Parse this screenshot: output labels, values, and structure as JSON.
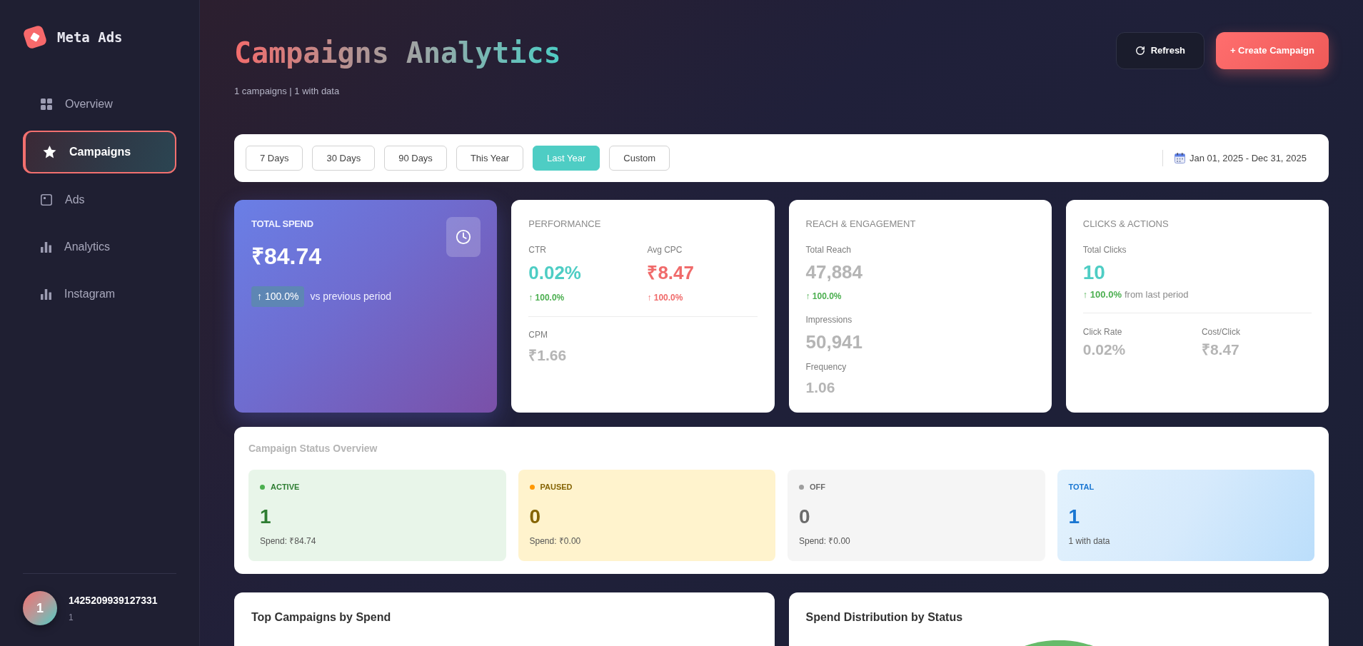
{
  "sidebar": {
    "brand": "Meta Ads",
    "items": [
      {
        "label": "Overview",
        "selected": false
      },
      {
        "label": "Campaigns",
        "selected": true
      },
      {
        "label": "Ads",
        "selected": false
      },
      {
        "label": "Analytics",
        "selected": false
      },
      {
        "label": "Instagram",
        "selected": false
      }
    ],
    "user": {
      "avatar": "1",
      "name": "1425209939127331",
      "subtitle": "1"
    }
  },
  "header": {
    "title": "Campaigns Analytics",
    "subtitle": "1 campaigns | 1 with data",
    "buttons": [
      {
        "label": "Refresh",
        "kind": "secondary"
      },
      {
        "label": "+ Create Campaign",
        "kind": "primary"
      }
    ]
  },
  "filters": {
    "ranges": [
      {
        "label": "7 Days",
        "selected": false
      },
      {
        "label": "30 Days",
        "selected": false
      },
      {
        "label": "90 Days",
        "selected": false
      },
      {
        "label": "This Year",
        "selected": false
      },
      {
        "label": "Last Year",
        "selected": true
      },
      {
        "label": "Custom",
        "selected": false
      }
    ],
    "date_range": "Jan 01, 2025 - Dec 31, 2025"
  },
  "total_spend": {
    "title": "TOTAL SPEND",
    "value": "₹84.74",
    "change": "↑ 100.0%",
    "note": "vs previous period"
  },
  "performance": {
    "title": "PERFORMANCE",
    "metrics": [
      {
        "label": "CTR",
        "value": "0.02%",
        "color": "#4ecdc4",
        "change": {
          "text": "↑ 100.0%",
          "color": "#4caf50"
        }
      },
      {
        "label": "Avg CPC",
        "value": "₹8.47",
        "color": "#f06b6b",
        "change": {
          "text": "↑ 100.0%",
          "color": "#f06b6b"
        }
      }
    ],
    "secondary": [
      {
        "label": "CPM",
        "value": "₹1.66",
        "color": "#b5b5b5"
      }
    ]
  },
  "reach": {
    "title": "REACH & ENGAGEMENT",
    "metrics": [
      {
        "label": "Total Reach",
        "value": "47,884",
        "color": "#b5b5b5",
        "change": {
          "text": "↑ 100.0%",
          "color": "#4caf50"
        }
      },
      {
        "label": "Impressions",
        "value": "50,941",
        "color": "#b5b5b5"
      }
    ],
    "secondary": [
      {
        "label": "Frequency",
        "value": "1.06",
        "color": "#b5b5b5"
      }
    ]
  },
  "clicks": {
    "title": "CLICKS & ACTIONS",
    "metric": {
      "label": "Total Clicks",
      "value": "10",
      "color": "#4ecdc4",
      "change": {
        "text": "↑ 100.0%",
        "color": "#4caf50"
      },
      "note": "from last period"
    },
    "secondary": [
      {
        "label": "Click Rate",
        "value": "0.02%",
        "color": "#b5b5b5"
      },
      {
        "label": "Cost/Click",
        "value": "₹8.47",
        "color": "#b5b5b5"
      }
    ]
  },
  "status_overview": {
    "title": "Campaign Status Overview",
    "items": [
      {
        "kind": "active",
        "label": "ACTIVE",
        "count": "1",
        "detail": "Spend: ₹84.74",
        "color": "#4caf50"
      },
      {
        "kind": "paused",
        "label": "PAUSED",
        "count": "0",
        "detail": "Spend: ₹0.00",
        "color": "#ff9800"
      },
      {
        "kind": "off",
        "label": "OFF",
        "count": "0",
        "detail": "Spend: ₹0.00",
        "color": "#9e9e9e"
      },
      {
        "kind": "total",
        "label": "TOTAL",
        "count": "1",
        "detail": "1 with data"
      }
    ]
  },
  "panels": [
    {
      "kind": "list",
      "title": "Top Campaigns by Spend"
    },
    {
      "kind": "pie",
      "title": "Spend Distribution by Status"
    }
  ]
}
